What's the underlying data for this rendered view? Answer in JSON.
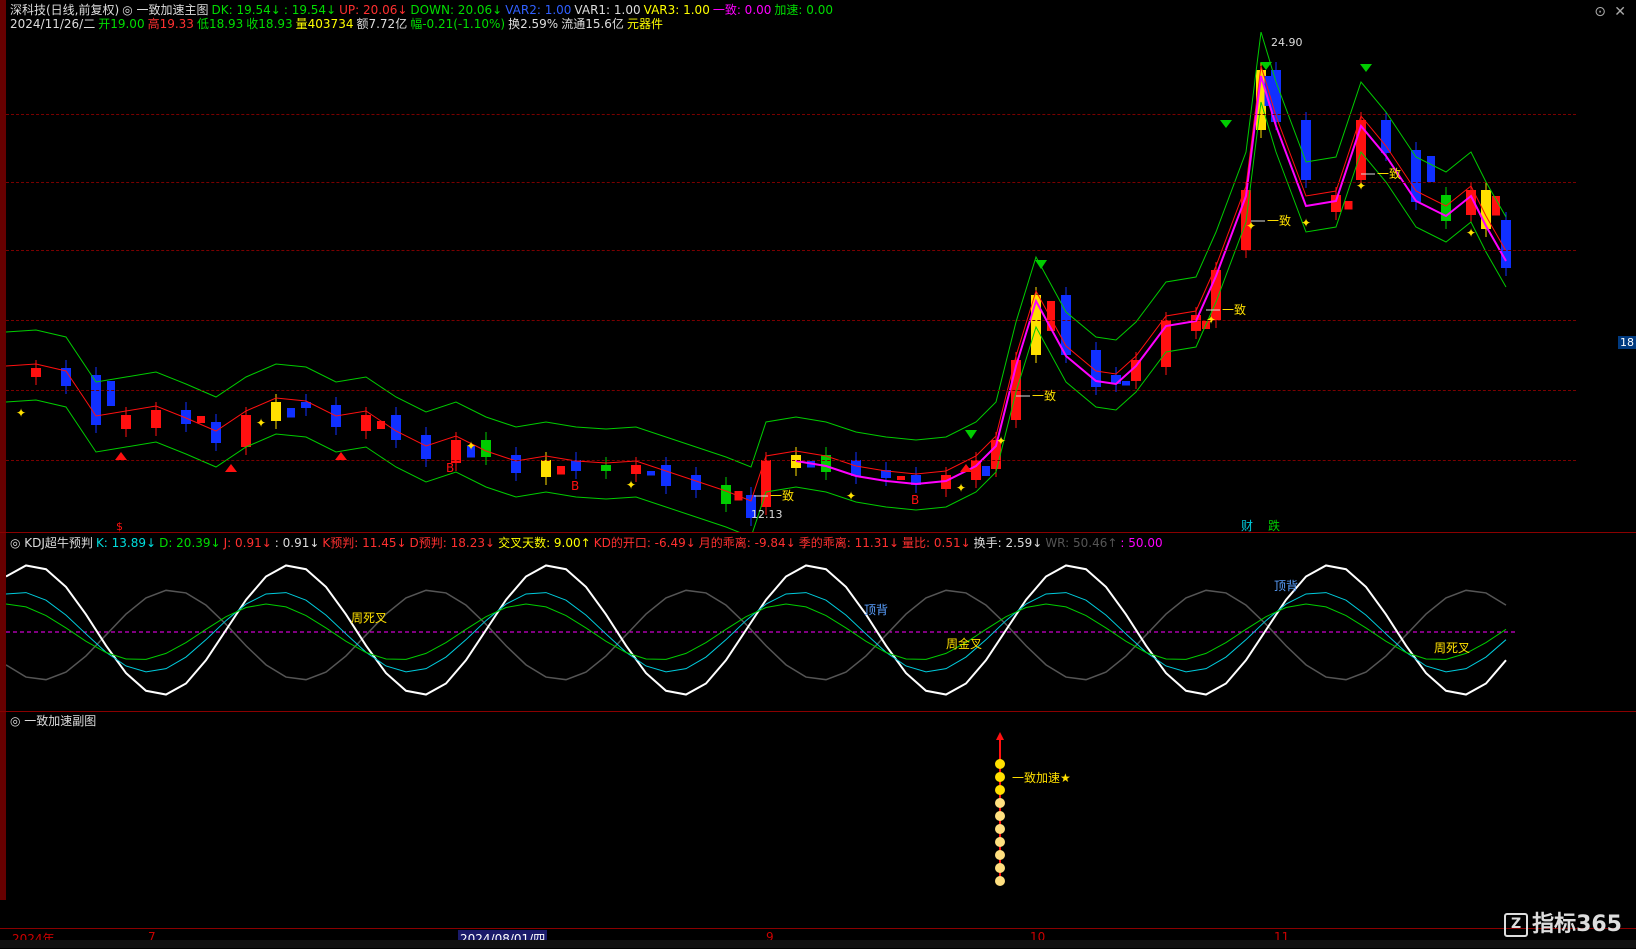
{
  "header": {
    "row1": [
      {
        "text": "深科技(日线,前复权)",
        "color": "#dddddd"
      },
      {
        "text": "◎ 一致加速主图",
        "color": "#dddddd"
      },
      {
        "text": "DK: 19.54↓",
        "color": "#00dd00"
      },
      {
        "text": ": 19.54↓",
        "color": "#00dd00"
      },
      {
        "text": "UP: 20.06↓",
        "color": "#ff3030"
      },
      {
        "text": "DOWN: 20.06↓",
        "color": "#00dd00"
      },
      {
        "text": "VAR2: 1.00",
        "color": "#3060ff"
      },
      {
        "text": "VAR1: 1.00",
        "color": "#dddddd"
      },
      {
        "text": "VAR3: 1.00",
        "color": "#ffff00"
      },
      {
        "text": "一致: 0.00",
        "color": "#ff00ff"
      },
      {
        "text": "加速: 0.00",
        "color": "#00dd00"
      }
    ],
    "row2": [
      {
        "text": "2024/11/26/二",
        "color": "#dddddd"
      },
      {
        "text": "开19.00",
        "color": "#00dd00"
      },
      {
        "text": "高19.33",
        "color": "#ff3030"
      },
      {
        "text": "低18.93",
        "color": "#00dd00"
      },
      {
        "text": "收18.93",
        "color": "#00dd00"
      },
      {
        "text": "量403734",
        "color": "#ffff00"
      },
      {
        "text": "额7.72亿",
        "color": "#dddddd"
      },
      {
        "text": "幅-0.21(-1.10%)",
        "color": "#00dd00"
      },
      {
        "text": "换2.59%",
        "color": "#dddddd"
      },
      {
        "text": "流通15.6亿",
        "color": "#dddddd"
      },
      {
        "text": "元器件",
        "color": "#ffff00"
      }
    ]
  },
  "main_chart": {
    "high_label": "24.90",
    "low_label": "12.13",
    "labels": {
      "yizhi": "一致",
      "dollar": "$",
      "cai": "财",
      "die": "跌",
      "B": "B"
    }
  },
  "kdj_panel": {
    "title": "◎ KDJ超牛预判",
    "values": [
      {
        "text": "K: 13.89↓",
        "color": "#00dddd"
      },
      {
        "text": "D: 20.39↓",
        "color": "#00dd00"
      },
      {
        "text": "J: 0.91↓",
        "color": "#ff3030"
      },
      {
        "text": ": 0.91↓",
        "color": "#dddddd"
      },
      {
        "text": "K预判: 11.45↓",
        "color": "#ff3030"
      },
      {
        "text": "D预判: 18.23↓",
        "color": "#ff3030"
      },
      {
        "text": "交叉天数: 9.00↑",
        "color": "#ffff00"
      },
      {
        "text": "KD的开口: -6.49↓",
        "color": "#ff3030"
      },
      {
        "text": "月的乖离: -9.84↓",
        "color": "#ff3030"
      },
      {
        "text": "季的乖离: 11.31↓",
        "color": "#ff3030"
      },
      {
        "text": "量比: 0.51↓",
        "color": "#ff3030"
      },
      {
        "text": "换手: 2.59↓",
        "color": "#dddddd"
      },
      {
        "text": "WR: 50.46↑",
        "color": "#555555"
      },
      {
        "text": ": 50.00",
        "color": "#ff00ff"
      }
    ],
    "annotations": {
      "sizhou": "周死叉",
      "dingbei": "顶背",
      "jinzhou": "周金叉"
    }
  },
  "sub_panel": {
    "title": "◎ 一致加速副图",
    "label": "一致加速★"
  },
  "time_axis": {
    "ticks": [
      {
        "text": "2024年",
        "color": "#cc0000"
      },
      {
        "text": "7",
        "color": "#cc0000"
      },
      {
        "text": "2024/08/01/四",
        "color": "#ffffff",
        "highlight": true
      },
      {
        "text": "9",
        "color": "#cc0000"
      },
      {
        "text": "10",
        "color": "#cc0000"
      },
      {
        "text": "11",
        "color": "#cc0000"
      }
    ]
  },
  "right_axis_tag": "18",
  "logo": {
    "text": "指标365",
    "mark": "Z"
  },
  "colors": {
    "up": "#ff1010",
    "down": "#1030ff",
    "yellow": "#ffe000",
    "green": "#00cc00",
    "magenta": "#ff00ff",
    "cyan": "#00ccdd",
    "white": "#ffffff",
    "gray": "#555555"
  }
}
